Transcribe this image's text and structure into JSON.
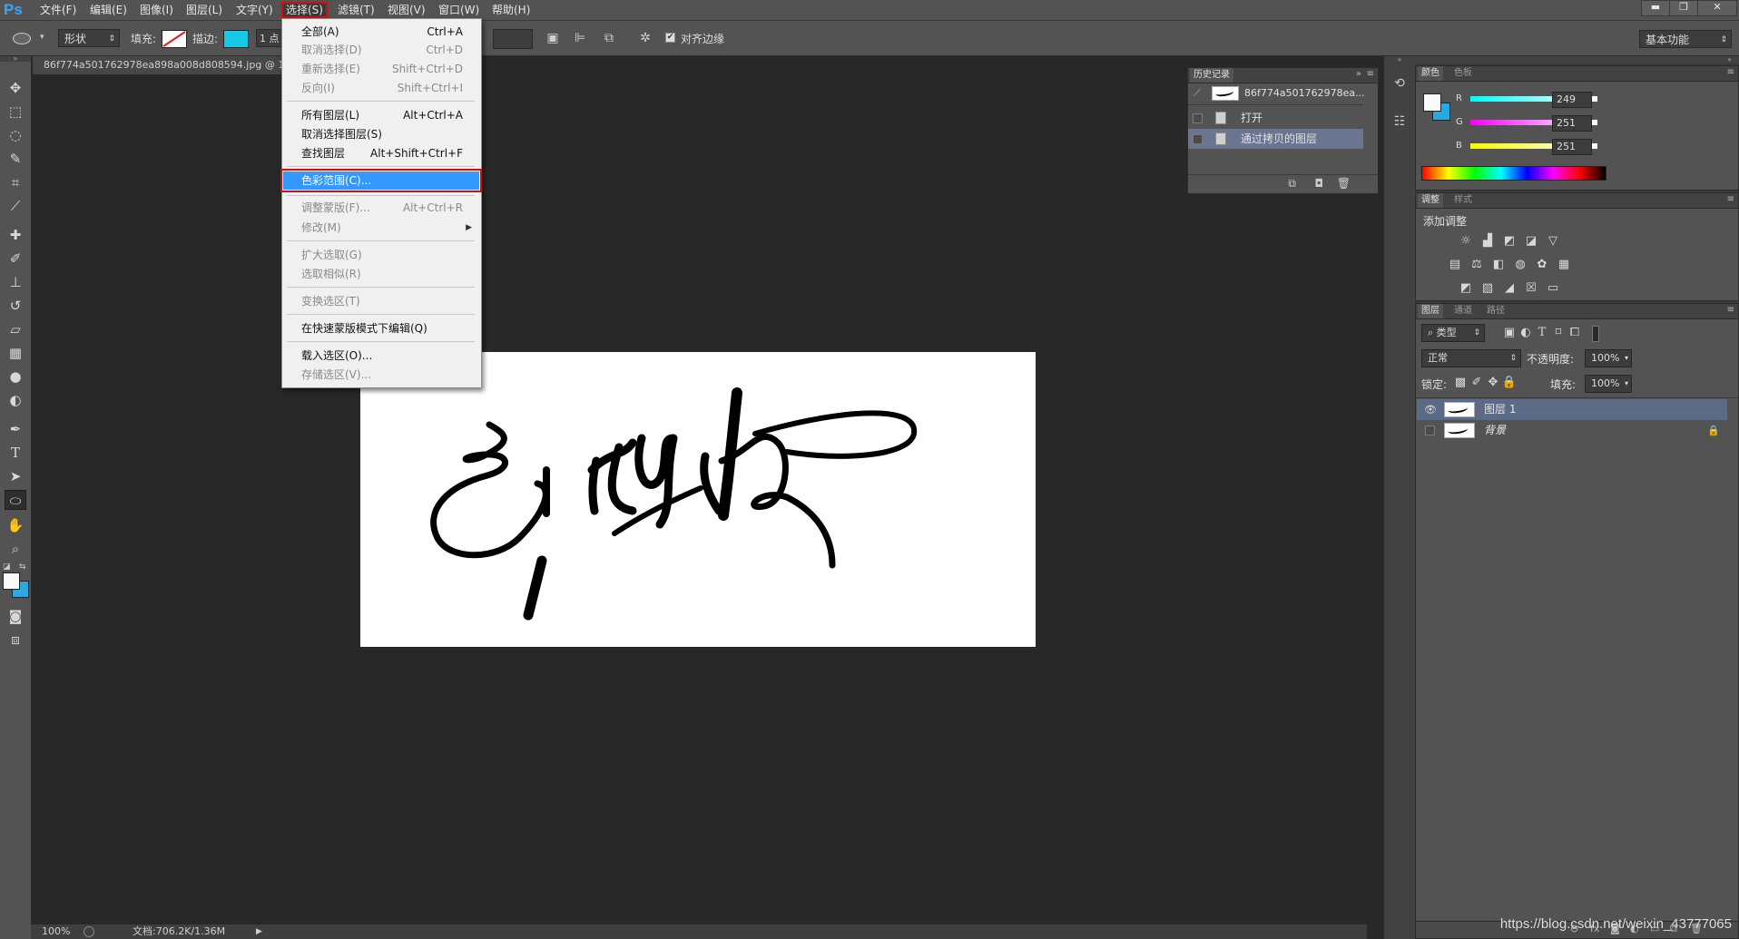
{
  "app": {
    "logo": "Ps"
  },
  "menubar": {
    "items": [
      "文件(F)",
      "编辑(E)",
      "图像(I)",
      "图层(L)",
      "文字(Y)",
      "选择(S)",
      "滤镜(T)",
      "视图(V)",
      "窗口(W)",
      "帮助(H)"
    ],
    "open_item": "选择(S)"
  },
  "window_controls": {
    "minimize": "▬",
    "restore": "❐",
    "close": "✕"
  },
  "options_bar": {
    "shape_mode": "形状",
    "fill_label": "填充:",
    "stroke_label": "描边:",
    "stroke_color": "#16c7e6",
    "stroke_width": "1 点",
    "align_edges_label": "对齐边缘",
    "workspace": "基本功能"
  },
  "document": {
    "tab_title": "86f774a501762978ea898a008d808594.jpg @ 10",
    "zoom": "100%",
    "doc_size": "文档:706.2K/1.36M"
  },
  "select_menu": {
    "groups": [
      [
        {
          "label": "全部(A)",
          "shortcut": "Ctrl+A",
          "enabled": true
        },
        {
          "label": "取消选择(D)",
          "shortcut": "Ctrl+D",
          "enabled": false
        },
        {
          "label": "重新选择(E)",
          "shortcut": "Shift+Ctrl+D",
          "enabled": false
        },
        {
          "label": "反向(I)",
          "shortcut": "Shift+Ctrl+I",
          "enabled": false
        }
      ],
      [
        {
          "label": "所有图层(L)",
          "shortcut": "Alt+Ctrl+A",
          "enabled": true
        },
        {
          "label": "取消选择图层(S)",
          "shortcut": "",
          "enabled": true
        },
        {
          "label": "查找图层",
          "shortcut": "Alt+Shift+Ctrl+F",
          "enabled": true
        }
      ],
      [
        {
          "label": "色彩范围(C)...",
          "shortcut": "",
          "enabled": true,
          "highlighted": true
        }
      ],
      [
        {
          "label": "调整蒙版(F)...",
          "shortcut": "Alt+Ctrl+R",
          "enabled": false
        },
        {
          "label": "修改(M)",
          "shortcut": "",
          "enabled": false,
          "submenu": true
        }
      ],
      [
        {
          "label": "扩大选取(G)",
          "shortcut": "",
          "enabled": false
        },
        {
          "label": "选取相似(R)",
          "shortcut": "",
          "enabled": false
        }
      ],
      [
        {
          "label": "变换选区(T)",
          "shortcut": "",
          "enabled": false
        }
      ],
      [
        {
          "label": "在快速蒙版模式下编辑(Q)",
          "shortcut": "",
          "enabled": true
        }
      ],
      [
        {
          "label": "载入选区(O)...",
          "shortcut": "",
          "enabled": true
        },
        {
          "label": "存储选区(V)...",
          "shortcut": "",
          "enabled": false
        }
      ]
    ]
  },
  "history_panel": {
    "tab": "历史记录",
    "snapshot": "86f774a501762978ea...",
    "steps": [
      {
        "label": "打开",
        "selected": false
      },
      {
        "label": "通过拷贝的图层",
        "selected": true
      }
    ]
  },
  "color_panel": {
    "tabs": [
      "颜色",
      "色板"
    ],
    "channels": [
      {
        "name": "R",
        "value": "249"
      },
      {
        "name": "G",
        "value": "251"
      },
      {
        "name": "B",
        "value": "251"
      }
    ],
    "foreground": "#f9fbfb",
    "background": "#2aa8e0"
  },
  "adjustments_panel": {
    "tabs": [
      "调整",
      "样式"
    ],
    "title": "添加调整",
    "icons": [
      "brightness-icon",
      "levels-icon",
      "curves-icon",
      "exposure-icon",
      "vibrance-icon",
      "hue-saturation-icon",
      "color-balance-icon",
      "black-white-icon",
      "photo-filter-icon",
      "channel-mixer-icon",
      "color-lookup-icon",
      "invert-icon",
      "posterize-icon",
      "threshold-icon",
      "gradient-map-icon",
      "selective-color-icon"
    ]
  },
  "layers_panel": {
    "tabs": [
      "图层",
      "通道",
      "路径"
    ],
    "filter_kind": "类型",
    "blend_mode": "正常",
    "opacity_label": "不透明度:",
    "opacity": "100%",
    "lock_label": "锁定:",
    "fill_label": "填充:",
    "fill": "100%",
    "layers": [
      {
        "name": "图层 1",
        "visible": true,
        "selected": true,
        "locked": false
      },
      {
        "name": "背景",
        "visible": false,
        "selected": false,
        "locked": true
      }
    ]
  },
  "watermark": "https://blog.csdn.net/weixin_43777065"
}
